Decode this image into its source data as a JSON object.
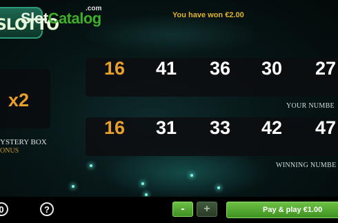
{
  "logo": {
    "badge_text": "SLOTTO",
    "word_part1": "Slot",
    "word_part2": "Catalog",
    "domain": ".com"
  },
  "win_message": "You have won €2.00",
  "your_numbers": {
    "values": [
      "16",
      "41",
      "36",
      "30",
      "27"
    ],
    "label": "YOUR NUMBE",
    "matched_index": 0
  },
  "winning_numbers": {
    "values": [
      "16",
      "31",
      "33",
      "42",
      "47"
    ],
    "label": "WINNING NUMBE",
    "matched_index": 0
  },
  "multiplier": {
    "value": "x2",
    "label": "YSTERY BOX",
    "sub_label": "ONUS"
  },
  "controls": {
    "left_icon": "0",
    "help_icon": "?",
    "minus_label": "-",
    "plus_label": "+",
    "play_label": "Pay & play €1.00"
  },
  "colors": {
    "accent_gold": "#e9a02a",
    "button_green": "#6cc043",
    "win_text": "#e1b52a"
  }
}
